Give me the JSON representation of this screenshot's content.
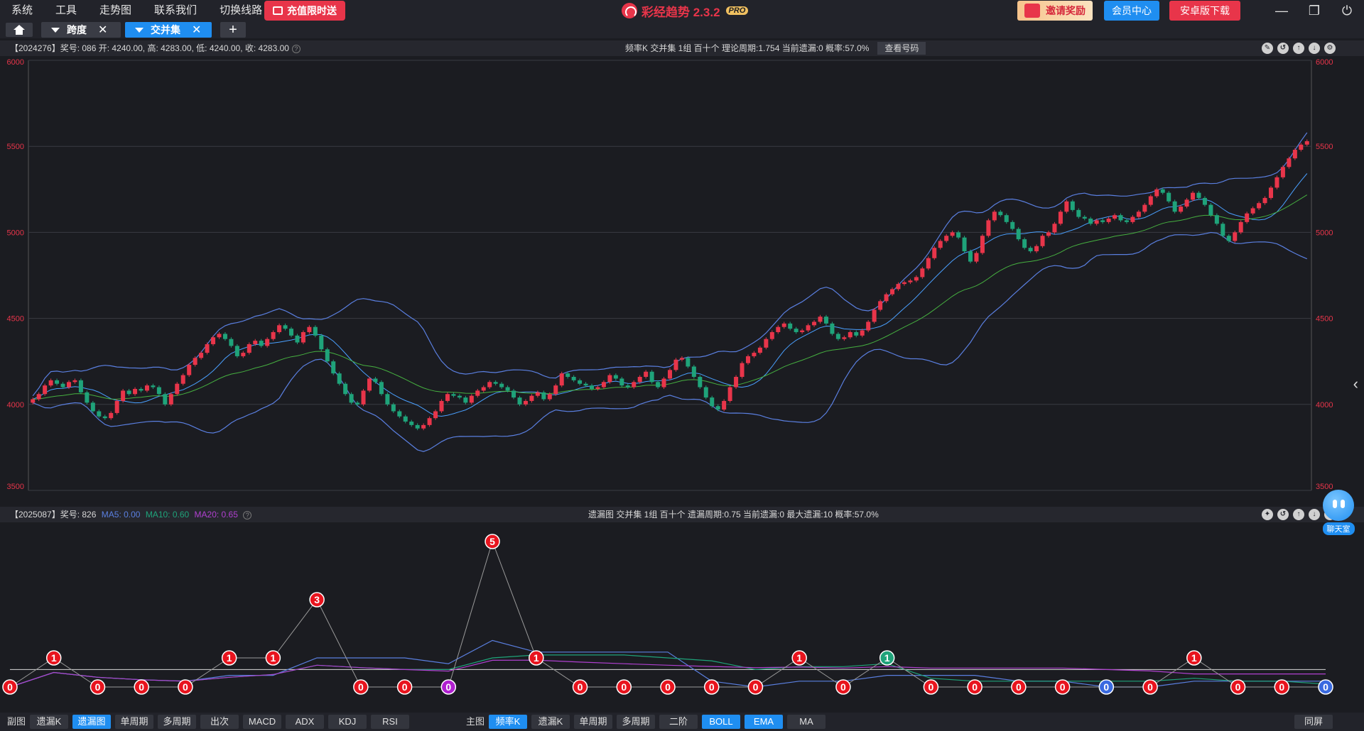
{
  "menu": [
    "系统",
    "工具",
    "走势图",
    "联系我们",
    "切换线路"
  ],
  "promo_label": "充值限时送",
  "brand": {
    "name": "彩经趋势 2.3.2",
    "badge": "PRO",
    "accent": "#e8354a"
  },
  "header_buttons": {
    "invite": "邀请奖励",
    "member": "会员中心",
    "android": "安卓版下载"
  },
  "tabs": [
    {
      "label": "跨度",
      "active": false
    },
    {
      "label": "交并集",
      "active": true
    }
  ],
  "main_panel": {
    "info": "【2024276】奖号: 086  开: 4240.00, 高: 4283.00, 低: 4240.00, 收: 4283.00",
    "stats": "频率K  交并集  1组  百十个  理论周期:1.754  当前遗漏:0  概率:57.0%",
    "view_btn": "查看号码"
  },
  "sub_panel": {
    "info_prefix": "【2025087】奖号: 826",
    "ma5": "MA5: 0.00",
    "ma10": "MA10: 0.60",
    "ma20": "MA20: 0.65",
    "stats": "遗漏图  交并集  1组  百十个  遗漏周期:0.75  当前遗漏:0  最大遗漏:10  概率:57.0%"
  },
  "chart_data": [
    {
      "type": "candlestick",
      "title": "",
      "ylim": [
        3500,
        6000
      ],
      "yticks": [
        "6000",
        "5500",
        "5000",
        "4500",
        "4000",
        "3500"
      ],
      "overlays": [
        "BOLL",
        "EMA"
      ],
      "colors": {
        "up": "#e8354a",
        "down": "#1fa37a",
        "boll": "#5a7fe0",
        "mid": "#4aa0ff",
        "ema": "#46b040"
      },
      "close_path": [
        4030,
        4060,
        4110,
        4140,
        4120,
        4100,
        4130,
        4140,
        4070,
        4010,
        3960,
        3930,
        3920,
        3950,
        4020,
        4080,
        4060,
        4090,
        4080,
        4110,
        4100,
        4060,
        4000,
        4060,
        4120,
        4170,
        4230,
        4270,
        4300,
        4350,
        4390,
        4410,
        4380,
        4340,
        4280,
        4300,
        4350,
        4370,
        4340,
        4380,
        4420,
        4460,
        4440,
        4400,
        4360,
        4420,
        4450,
        4400,
        4320,
        4250,
        4180,
        4120,
        4060,
        4010,
        4000,
        4080,
        4150,
        4130,
        4060,
        4000,
        3960,
        3930,
        3900,
        3880,
        3860,
        3880,
        3920,
        3960,
        4020,
        4060,
        4050,
        4040,
        4010,
        4050,
        4080,
        4100,
        4130,
        4120,
        4100,
        4080,
        4040,
        4000,
        4020,
        4050,
        4070,
        4030,
        4060,
        4110,
        4180,
        4160,
        4140,
        4120,
        4110,
        4090,
        4100,
        4130,
        4170,
        4150,
        4110,
        4100,
        4130,
        4160,
        4190,
        4130,
        4100,
        4150,
        4200,
        4260,
        4270,
        4220,
        4160,
        4100,
        4040,
        3990,
        3970,
        4020,
        4100,
        4160,
        4240,
        4280,
        4300,
        4330,
        4380,
        4420,
        4450,
        4470,
        4440,
        4420,
        4430,
        4460,
        4480,
        4510,
        4470,
        4410,
        4380,
        4390,
        4420,
        4400,
        4430,
        4480,
        4550,
        4600,
        4640,
        4670,
        4700,
        4710,
        4720,
        4740,
        4790,
        4850,
        4910,
        4950,
        4980,
        5000,
        4970,
        4890,
        4830,
        4880,
        4980,
        5070,
        5120,
        5100,
        5060,
        5020,
        4960,
        4910,
        4890,
        4920,
        4980,
        5000,
        5050,
        5120,
        5180,
        5130,
        5090,
        5080,
        5050,
        5070,
        5060,
        5080,
        5100,
        5070,
        5060,
        5090,
        5120,
        5160,
        5210,
        5250,
        5230,
        5180,
        5120,
        5150,
        5190,
        5230,
        5200,
        5160,
        5100,
        5050,
        4980,
        4950,
        5000,
        5060,
        5110,
        5140,
        5170,
        5200,
        5260,
        5320,
        5380,
        5430,
        5480,
        5510,
        5530
      ]
    },
    {
      "type": "line",
      "title": "",
      "values": [
        0,
        1,
        0,
        0,
        0,
        1,
        1,
        3,
        0,
        0,
        0,
        5,
        1,
        0,
        0,
        0,
        0,
        0,
        1,
        0,
        1,
        0,
        0,
        0,
        0,
        0,
        0,
        1,
        0,
        0,
        0
      ],
      "labels": [
        "0",
        "1",
        "0",
        "0",
        "0",
        "1",
        "1",
        "3",
        "0",
        "0",
        "0",
        "5",
        "1",
        "0",
        "0",
        "0",
        "0",
        "0",
        "1",
        "0",
        "1",
        "0",
        "0",
        "0",
        "0",
        "0",
        "0",
        "1",
        "0",
        "0",
        "0"
      ],
      "series": [
        {
          "name": "MA5"
        },
        {
          "name": "MA10"
        },
        {
          "name": "MA20"
        }
      ]
    }
  ],
  "bottom": {
    "sub_label": "副图",
    "sub_buttons": [
      {
        "label": "遗漏K",
        "on": false
      },
      {
        "label": "遗漏图",
        "on": true
      },
      {
        "label": "单周期",
        "on": false
      },
      {
        "label": "多周期",
        "on": false
      },
      {
        "label": "出次",
        "on": false
      },
      {
        "label": "MACD",
        "on": false
      },
      {
        "label": "ADX",
        "on": false
      },
      {
        "label": "KDJ",
        "on": false
      },
      {
        "label": "RSI",
        "on": false
      }
    ],
    "main_label": "主图",
    "main_buttons": [
      {
        "label": "频率K",
        "on": true
      },
      {
        "label": "遗漏K",
        "on": false
      },
      {
        "label": "单周期",
        "on": false
      },
      {
        "label": "多周期",
        "on": false
      },
      {
        "label": "二阶",
        "on": false
      },
      {
        "label": "BOLL",
        "on": true
      },
      {
        "label": "EMA",
        "on": true
      },
      {
        "label": "MA",
        "on": false
      }
    ],
    "fullscreen": "同屏"
  },
  "chat_label": "聊天室"
}
